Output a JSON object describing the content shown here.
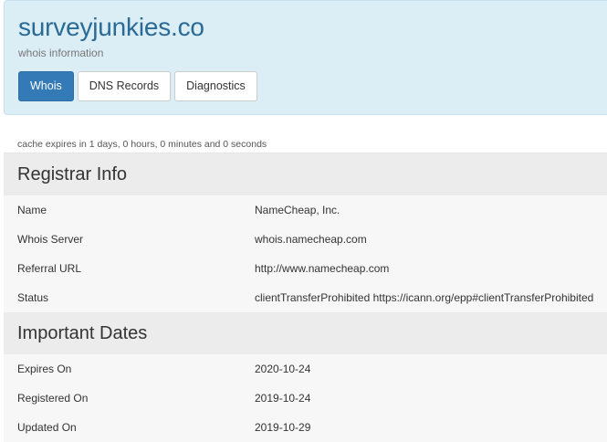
{
  "header": {
    "domain": "surveyjunkies.co",
    "subtitle": "whois information",
    "tabs": [
      {
        "label": "Whois",
        "active": true
      },
      {
        "label": "DNS Records",
        "active": false
      },
      {
        "label": "Diagnostics",
        "active": false
      }
    ]
  },
  "cache_note": "cache expires in 1 days, 0 hours, 0 minutes and 0 seconds",
  "registrar": {
    "title": "Registrar Info",
    "rows": [
      {
        "label": "Name",
        "value": "NameCheap, Inc."
      },
      {
        "label": "Whois Server",
        "value": "whois.namecheap.com"
      },
      {
        "label": "Referral URL",
        "value": "http://www.namecheap.com"
      },
      {
        "label": "Status",
        "value": "clientTransferProhibited https://icann.org/epp#clientTransferProhibited"
      }
    ]
  },
  "dates": {
    "title": "Important Dates",
    "rows": [
      {
        "label": "Expires On",
        "value": "2020-10-24"
      },
      {
        "label": "Registered On",
        "value": "2019-10-24"
      },
      {
        "label": "Updated On",
        "value": "2019-10-29"
      }
    ]
  },
  "colors": {
    "header_bg": "#dbedf5",
    "title": "#2a6b96",
    "active_tab": "#337ab7"
  }
}
